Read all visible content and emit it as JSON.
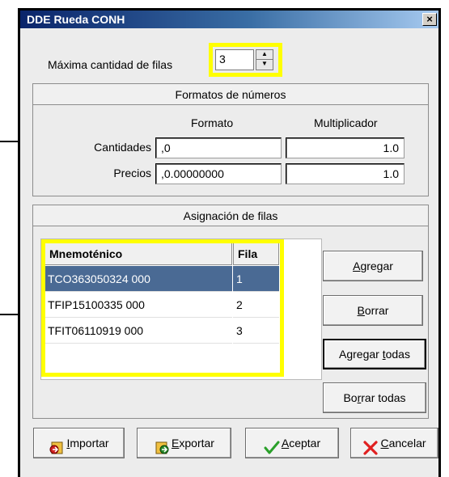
{
  "window": {
    "title": "DDE Rueda CONH",
    "close_label": "×"
  },
  "max_rows": {
    "label": "Máxima cantidad de filas",
    "value": "3"
  },
  "number_formats": {
    "header": "Formatos de números",
    "col_format": "Formato",
    "col_multiplier": "Multiplicador",
    "rows": [
      {
        "label": "Cantidades",
        "format": ",0",
        "multiplier": "1.0"
      },
      {
        "label": "Precios",
        "format": ",0.00000000",
        "multiplier": "1.0"
      }
    ]
  },
  "row_assignment": {
    "header": "Asignación de filas",
    "columns": [
      "Mnemoténico",
      "Fila"
    ],
    "rows": [
      {
        "mnemonic": "TCO363050324 000",
        "row": "1"
      },
      {
        "mnemonic": "TFIP15100335 000",
        "row": "2"
      },
      {
        "mnemonic": "TFIT06110919 000",
        "row": "3"
      }
    ],
    "buttons": {
      "agregar": {
        "pre": "",
        "u": "A",
        "post": "gregar"
      },
      "borrar": {
        "pre": "",
        "u": "B",
        "post": "orrar"
      },
      "agregar_todas": {
        "pre": "Agregar ",
        "u": "t",
        "post": "odas"
      },
      "borrar_todas": {
        "pre": "Bo",
        "u": "r",
        "post": "rar todas"
      }
    }
  },
  "footer": {
    "importar": {
      "pre": "",
      "u": "I",
      "post": "mportar"
    },
    "exportar": {
      "pre": "",
      "u": "E",
      "post": "xportar"
    },
    "aceptar": {
      "pre": "",
      "u": "A",
      "post": "ceptar"
    },
    "cancelar": {
      "pre": "",
      "u": "C",
      "post": "ancelar"
    }
  },
  "colors": {
    "highlight": "#ffff00",
    "selection": "#4a6a94",
    "title_start": "#0a246a"
  },
  "icons": [
    "close-icon",
    "spin-up-icon",
    "spin-down-icon",
    "import-icon",
    "export-icon",
    "checkmark-icon",
    "x-icon"
  ]
}
